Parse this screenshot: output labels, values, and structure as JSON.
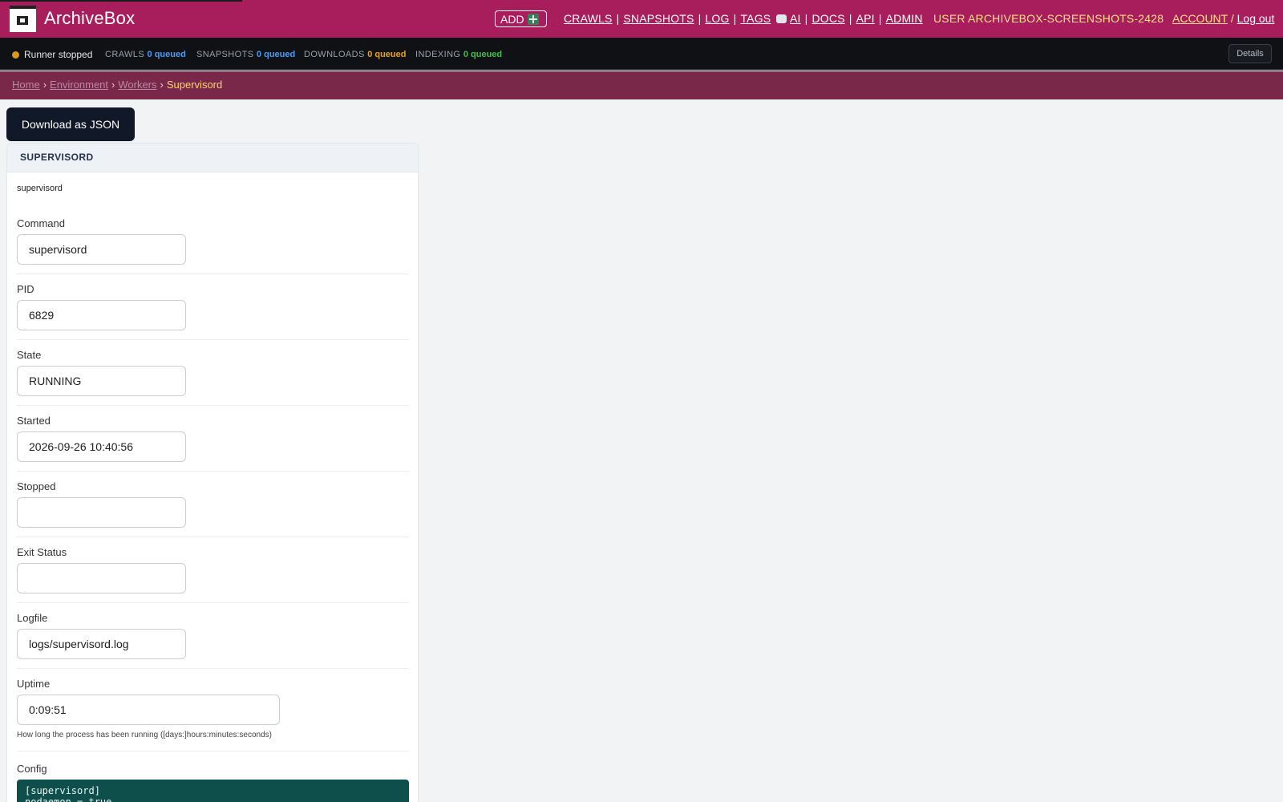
{
  "header": {
    "app_title": "ArchiveBox",
    "add_label": "ADD",
    "nav_main": [
      "CRAWLS",
      "SNAPSHOTS",
      "LOG",
      "TAGS"
    ],
    "nav_tools": [
      "AI",
      "DOCS",
      "API",
      "ADMIN"
    ],
    "user_label": "USER ARCHIVEBOX-SCREENSHOTS-2428",
    "account_label": "ACCOUNT",
    "account_sep": "/",
    "logout_label": "Log out"
  },
  "status": {
    "runner": "Runner stopped",
    "crawls_label": "CRAWLS",
    "crawls_value": "0 queued",
    "snapshots_label": "SNAPSHOTS",
    "snapshots_value": "0 queued",
    "downloads_label": "DOWNLOADS",
    "downloads_value": "0 queued",
    "indexing_label": "INDEXING",
    "indexing_value": "0 queued",
    "details_label": "Details",
    "colors": {
      "runner_dot": "#d89a1c",
      "crawls": "#4b9cf5",
      "snapshots": "#4b9cf5",
      "downloads": "#e8a317",
      "indexing": "#3fbf4f"
    }
  },
  "breadcrumb": {
    "home": "Home",
    "environment": "Environment",
    "workers": "Workers",
    "current": "Supervisord",
    "separator": "›"
  },
  "actions": {
    "download_json": "Download as JSON"
  },
  "card": {
    "title": "SUPERVISORD",
    "subtitle": "supervisord",
    "fields": {
      "command": {
        "label": "Command",
        "value": "supervisord"
      },
      "pid": {
        "label": "PID",
        "value": "6829"
      },
      "state": {
        "label": "State",
        "value": "RUNNING"
      },
      "started": {
        "label": "Started",
        "value": "2026-09-26 10:40:56"
      },
      "stopped": {
        "label": "Stopped",
        "value": ""
      },
      "exit_status": {
        "label": "Exit Status",
        "value": ""
      },
      "logfile": {
        "label": "Logfile",
        "value": "logs/supervisord.log"
      },
      "uptime": {
        "label": "Uptime",
        "value": "0:09:51",
        "help": "How long the process has been running ([days:]hours:minutes:seconds)"
      }
    },
    "config": {
      "label": "Config",
      "lines": "[supervisord]\nnodaemon = true"
    }
  },
  "theme": {
    "brand": "#a81d5b",
    "breadcrumb_bg": "#79284a",
    "config_bg": "#0f4f4b"
  }
}
